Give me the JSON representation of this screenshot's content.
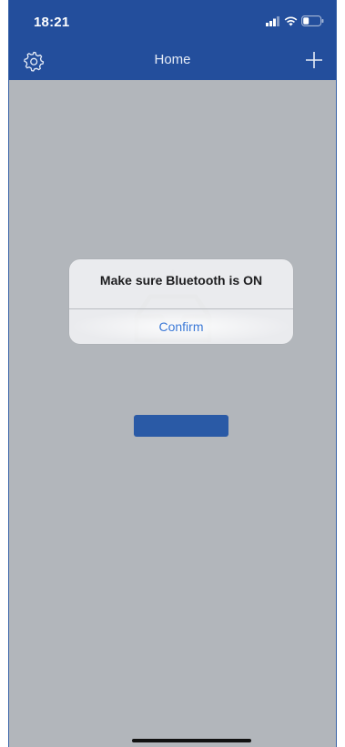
{
  "status_bar": {
    "time": "18:21",
    "signal_icon": "signal-bars-icon",
    "wifi_icon": "wifi-icon",
    "battery_icon": "battery-icon"
  },
  "nav": {
    "title": "Home",
    "settings_icon": "gear-icon",
    "add_icon": "plus-icon"
  },
  "alert": {
    "message": "Make sure Bluetooth is ON",
    "confirm_label": "Confirm"
  },
  "colors": {
    "header": "#234e9c",
    "overlay": "#b2b6bb",
    "accent": "#3a78d6"
  }
}
